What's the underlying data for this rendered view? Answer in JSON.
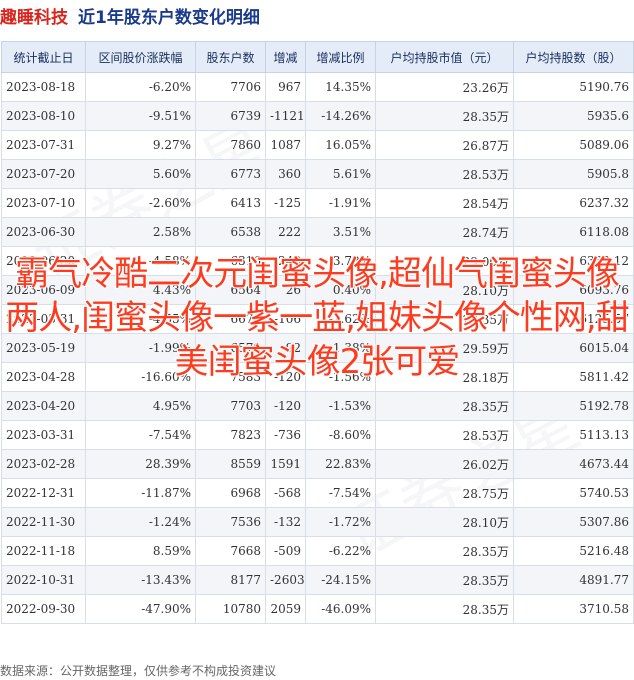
{
  "header": {
    "company": "趣睡科技",
    "subtitle": "近1年股东户数变化明细"
  },
  "table": {
    "columns": [
      "统计截止日",
      "区间股价涨跌幅",
      "股东户数",
      "增减",
      "增减比例",
      "户均持股市值（元）",
      "户均持股数（股）"
    ],
    "rows": [
      {
        "date": "2023-08-18",
        "chg": "-6.20%",
        "holders": "7706",
        "delta": "967",
        "ratio": "14.35%",
        "avg_value": "23.26万",
        "avg_shares": "5190.76"
      },
      {
        "date": "2023-08-10",
        "chg": "-9.51%",
        "holders": "6739",
        "delta": "-1121",
        "ratio": "-14.26%",
        "avg_value": "28.35万",
        "avg_shares": "5935.6"
      },
      {
        "date": "2023-07-31",
        "chg": "9.27%",
        "holders": "7860",
        "delta": "1087",
        "ratio": "16.05%",
        "avg_value": "26.87万",
        "avg_shares": "5089.06"
      },
      {
        "date": "2023-07-20",
        "chg": "5.60%",
        "holders": "6773",
        "delta": "360",
        "ratio": "5.61%",
        "avg_value": "28.53万",
        "avg_shares": "5905.8"
      },
      {
        "date": "2023-07-10",
        "chg": "-2.60%",
        "holders": "6413",
        "delta": "-125",
        "ratio": "-1.91%",
        "avg_value": "28.54万",
        "avg_shares": "6237.32"
      },
      {
        "date": "2023-06-30",
        "chg": "2.58%",
        "holders": "6538",
        "delta": "222",
        "ratio": "3.51%",
        "avg_value": "28.74万",
        "avg_shares": "6118.08"
      },
      {
        "date": "2023-06-20",
        "chg": "-4.58%",
        "holders": "6316",
        "delta": "-248",
        "ratio": "-3.78%",
        "avg_value": "29.00万",
        "avg_shares": "6333.12"
      },
      {
        "date": "2023-06-09",
        "chg": "4.43%",
        "holders": "6564",
        "delta": "26",
        "ratio": "0.40%",
        "avg_value": "28.10万",
        "avg_shares": "6093.76"
      },
      {
        "date": "2023-05-31",
        "chg": "-4.55%",
        "holders": "6670",
        "delta": "-106",
        "ratio": "-1.62%",
        "avg_value": "28.35万",
        "avg_shares": "6125.57"
      },
      {
        "date": "2023-05-19",
        "chg": "-1.99%",
        "holders": "6578",
        "delta": "-92",
        "ratio": "-1.38%",
        "avg_value": "29.59万",
        "avg_shares": "6015.04"
      },
      {
        "date": "2023-04-28",
        "chg": "-16.60%",
        "holders": "7583",
        "delta": "-120",
        "ratio": "-1.56%",
        "avg_value": "28.18万",
        "avg_shares": "5811.42"
      },
      {
        "date": "2023-04-20",
        "chg": "4.95%",
        "holders": "7703",
        "delta": "-120",
        "ratio": "-1.53%",
        "avg_value": "28.35万",
        "avg_shares": "5192.78"
      },
      {
        "date": "2023-03-31",
        "chg": "-7.54%",
        "holders": "7823",
        "delta": "-736",
        "ratio": "-8.60%",
        "avg_value": "28.53万",
        "avg_shares": "5113.13"
      },
      {
        "date": "2023-02-28",
        "chg": "28.39%",
        "holders": "8559",
        "delta": "1591",
        "ratio": "22.83%",
        "avg_value": "26.02万",
        "avg_shares": "4673.44"
      },
      {
        "date": "2022-12-31",
        "chg": "-11.87%",
        "holders": "6968",
        "delta": "-568",
        "ratio": "-7.54%",
        "avg_value": "28.75万",
        "avg_shares": "5740.53"
      },
      {
        "date": "2022-11-30",
        "chg": "-1.24%",
        "holders": "7536",
        "delta": "-132",
        "ratio": "-1.72%",
        "avg_value": "28.10万",
        "avg_shares": "5307.86"
      },
      {
        "date": "2022-11-18",
        "chg": "8.59%",
        "holders": "7668",
        "delta": "-509",
        "ratio": "-6.22%",
        "avg_value": "28.35万",
        "avg_shares": "5216.48"
      },
      {
        "date": "2022-10-31",
        "chg": "-13.43%",
        "holders": "8177",
        "delta": "-2603",
        "ratio": "-24.15%",
        "avg_value": "28.35万",
        "avg_shares": "4891.77"
      },
      {
        "date": "2022-09-30",
        "chg": "-47.90%",
        "holders": "10780",
        "delta": "2059",
        "ratio": "-46.09%",
        "avg_value": "28.35万",
        "avg_shares": "3710.58"
      }
    ]
  },
  "overlay_text": "霸气冷酷二次元闺蜜头像,超仙气闺蜜头像两人,闺蜜头像一紫一蓝,姐妹头像个性网,甜美闺蜜头像2张可爱",
  "source": "数据来源：公开数据整理，仅供参考不构成投资建议",
  "colors": {
    "up": "#e0301e",
    "down": "#16a34a",
    "brand": "#d9261c",
    "title": "#1b3a8c"
  }
}
